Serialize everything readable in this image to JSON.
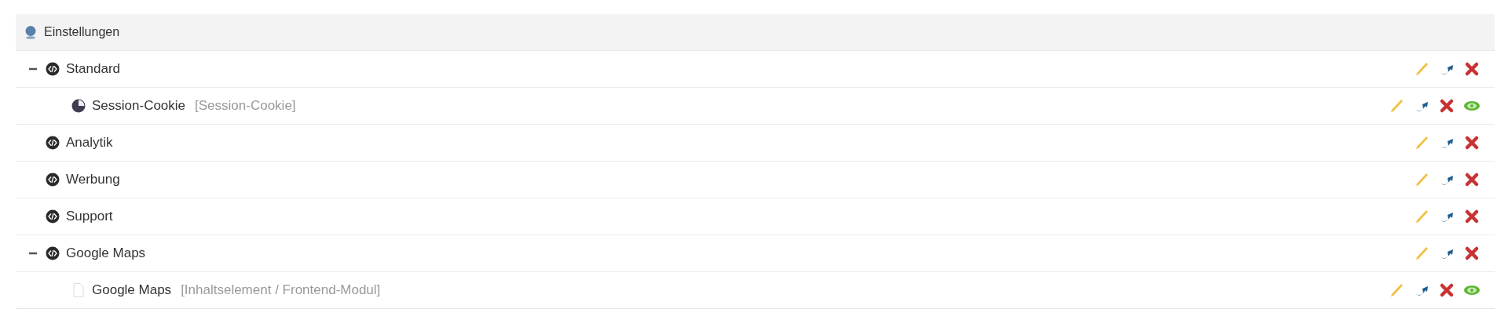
{
  "header": {
    "title": "Einstellungen"
  },
  "tree": [
    {
      "kind": "group",
      "label": "Standard",
      "expanded": true,
      "children": [
        {
          "kind": "cookie",
          "label": "Session-Cookie",
          "type": "[Session-Cookie]"
        }
      ]
    },
    {
      "kind": "group",
      "label": "Analytik"
    },
    {
      "kind": "group",
      "label": "Werbung"
    },
    {
      "kind": "group",
      "label": "Support"
    },
    {
      "kind": "group",
      "label": "Google Maps",
      "expanded": true,
      "children": [
        {
          "kind": "element",
          "label": "Google Maps",
          "type": "[Inhaltselement / Frontend-Modul]"
        }
      ]
    }
  ]
}
